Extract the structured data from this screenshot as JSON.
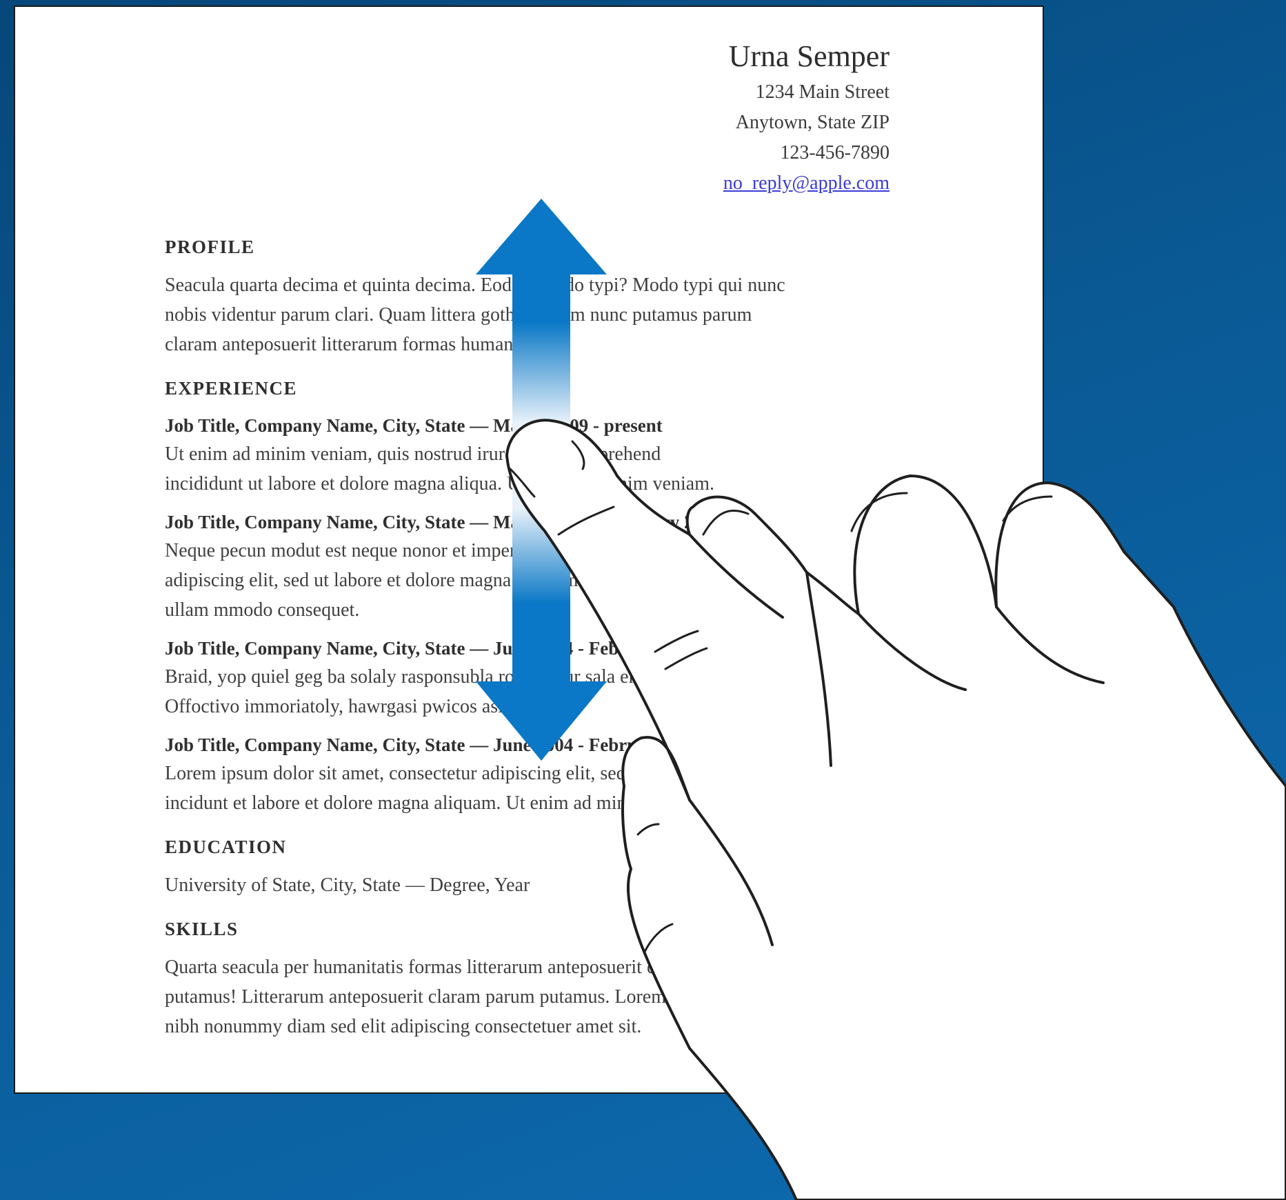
{
  "resume": {
    "name": "Urna Semper",
    "address_line1": "1234 Main Street",
    "address_line2": "Anytown, State ZIP",
    "phone": "123-456-7890",
    "email": "no_reply@apple.com",
    "profile": {
      "heading": "PROFILE",
      "lines": [
        "Seacula quarta decima et quinta decima. Eodem modo typi? Modo typi qui nunc",
        "nobis videntur parum clari. Quam littera gothica quam nunc putamus parum",
        "claram anteposuerit litterarum formas humanitatis."
      ]
    },
    "experience": {
      "heading": "EXPERIENCE",
      "jobs": [
        {
          "title": "Job Title, Company Name, City, State — March 2009 - present",
          "lines": [
            "Ut enim ad minim veniam, quis nostrud irure dolor in reprehend",
            "incididunt ut labore et dolore magna aliqua. Ut enim ad minim veniam."
          ]
        },
        {
          "title": "Job Title, Company Name, City, State — March 2006 - February 2009",
          "lines": [
            "Neque pecun modut est neque nonor et imper ned libidig met, consectetur",
            "adipiscing elit, sed ut labore et dolore magna aliquam makes one wash,",
            "ullam mmodo consequet."
          ]
        },
        {
          "title": "Job Title, Company Name, City, State — June 2004 - February 2006",
          "lines": [
            "Braid, yop quiel geg ba solaly rasponsubla rof trenzur sala ent dusgrubuswo.",
            "Offoctivo immoriatoly, hawrgasi pwicos asi sirucor."
          ]
        },
        {
          "title": "Job Title, Company Name, City, State — June 2004 - February 2006",
          "lines": [
            "Lorem ipsum dolor sit amet, consectetur adipiscing elit, sed do eiusmod tempor",
            "incidunt et labore et dolore magna aliquam. Ut enim ad minim veniam."
          ]
        }
      ]
    },
    "education": {
      "heading": "EDUCATION",
      "line": "University of State, City, State — Degree, Year"
    },
    "skills": {
      "heading": "SKILLS",
      "lines": [
        "Quarta seacula per humanitatis formas litterarum anteposuerit claram parum",
        "putamus! Litterarum anteposuerit claram parum putamus. Lorem ipsum dolor",
        "nibh nonummy diam sed elit adipiscing consectetuer amet sit."
      ]
    }
  },
  "gesture": {
    "type": "vertical-scroll",
    "arrow_color": "#0a78c6"
  }
}
